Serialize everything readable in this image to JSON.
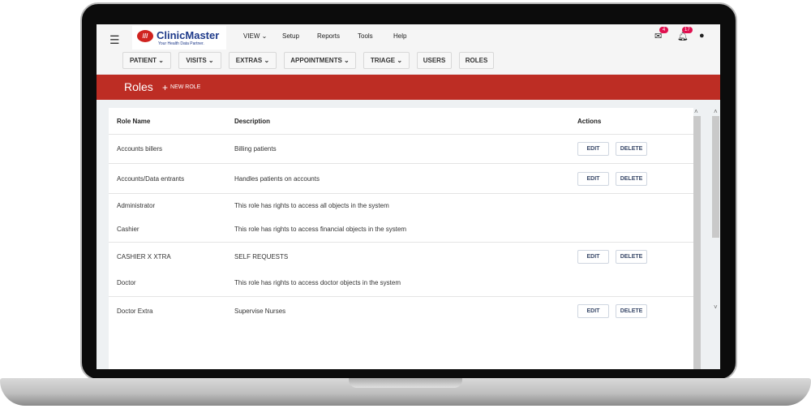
{
  "header": {
    "logo_name": "ClinicMaster",
    "logo_tagline": "Your Health Data Partner.",
    "menu": [
      "VIEW",
      "Setup",
      "Reports",
      "Tools",
      "Help"
    ],
    "mail_count": "4",
    "notif_count": "17"
  },
  "nav": [
    "PATIENT",
    "VISITS",
    "EXTRAS",
    "APPOINTMENTS",
    "TRIAGE",
    "USERS",
    "ROLES"
  ],
  "page": {
    "title": "Roles",
    "new_role": "NEW ROLE"
  },
  "table": {
    "headers": [
      "Role Name",
      "Description",
      "Actions"
    ],
    "rows": [
      {
        "name": "Accounts billers",
        "desc": "Billing patients",
        "edit": "EDIT",
        "delete": "DELETE"
      },
      {
        "name": "Accounts/Data entrants",
        "desc": "Handles patients on accounts",
        "edit": "EDIT",
        "delete": "DELETE"
      },
      {
        "name": "Administrator",
        "desc": "This role has rights to access all objects in the system"
      },
      {
        "name": "Cashier",
        "desc": "This role has rights to access financial objects in the system"
      },
      {
        "name": "CASHIER X XTRA",
        "desc": "SELF REQUESTS",
        "edit": "EDIT",
        "delete": "DELETE"
      },
      {
        "name": "Doctor",
        "desc": "This role has rights to access doctor objects in the system"
      },
      {
        "name": "Doctor Extra",
        "desc": "Supervise Nurses",
        "edit": "EDIT",
        "delete": "DELETE"
      }
    ]
  },
  "colors": {
    "brand_red": "#bd2d24",
    "badge": "#e0104f"
  }
}
